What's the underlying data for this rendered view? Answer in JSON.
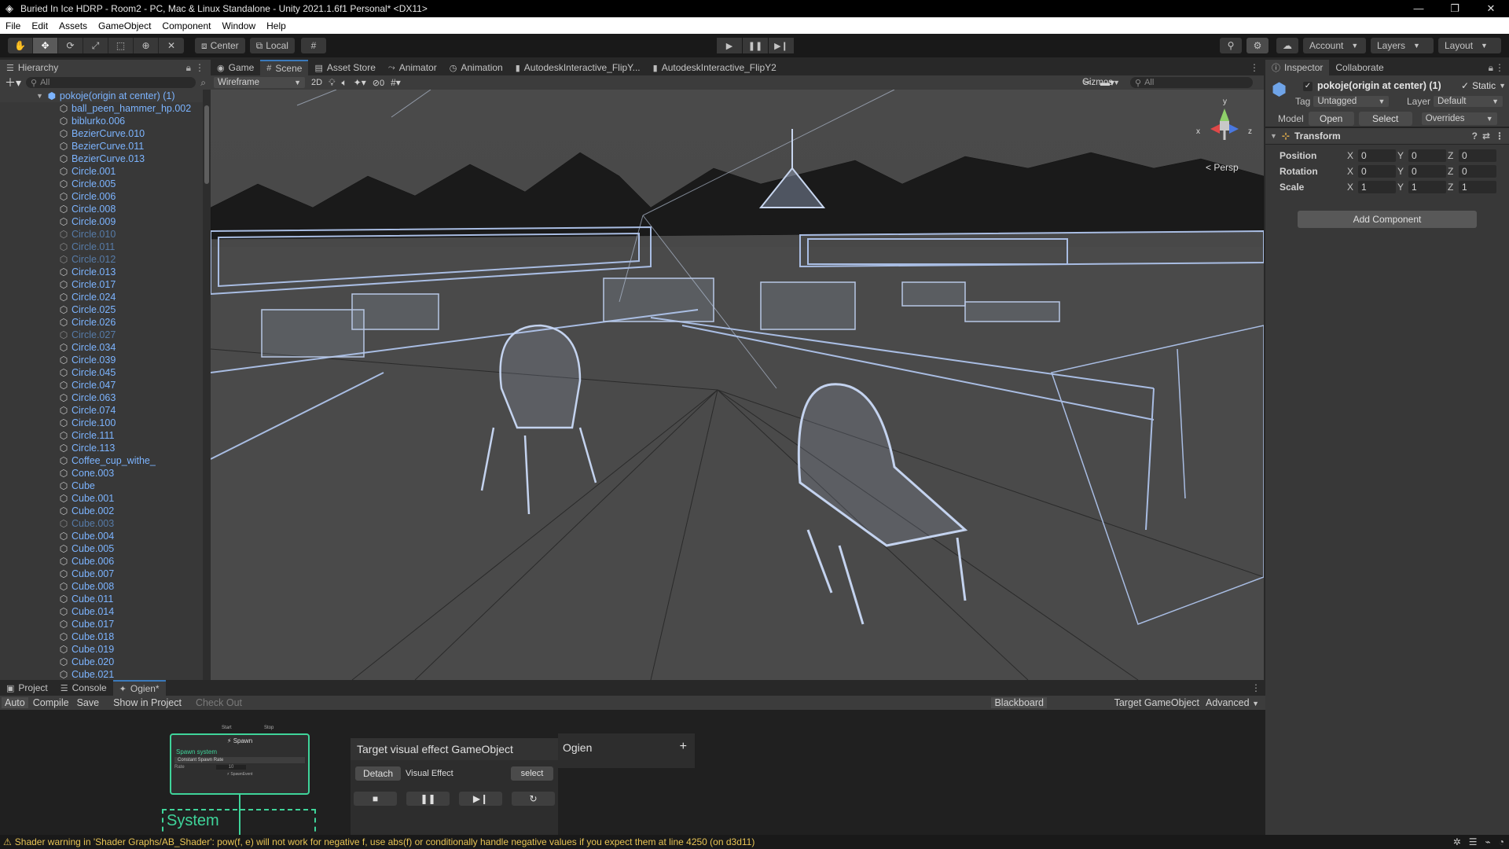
{
  "window": {
    "title": "Buried In Ice HDRP - Room2 - PC, Mac & Linux Standalone - Unity 2021.1.6f1 Personal* <DX11>",
    "controls": [
      "—",
      "❐",
      "✕"
    ]
  },
  "menu": [
    "File",
    "Edit",
    "Assets",
    "GameObject",
    "Component",
    "Window",
    "Help"
  ],
  "toolbar": {
    "pivot_mode": "Center",
    "pivot_rotation": "Local",
    "account": "Account",
    "layers": "Layers",
    "layout": "Layout"
  },
  "hierarchy": {
    "tab": "Hierarchy",
    "search_placeholder": "All",
    "root": "pokoje(origin at center) (1)",
    "items": [
      {
        "name": "ball_peen_hammer_hp.002",
        "dim": false
      },
      {
        "name": "biblurko.006",
        "dim": false
      },
      {
        "name": "BezierCurve.010",
        "dim": false
      },
      {
        "name": "BezierCurve.011",
        "dim": false
      },
      {
        "name": "BezierCurve.013",
        "dim": false
      },
      {
        "name": "Circle.001",
        "dim": false
      },
      {
        "name": "Circle.005",
        "dim": false
      },
      {
        "name": "Circle.006",
        "dim": false
      },
      {
        "name": "Circle.008",
        "dim": false
      },
      {
        "name": "Circle.009",
        "dim": false
      },
      {
        "name": "Circle.010",
        "dim": true
      },
      {
        "name": "Circle.011",
        "dim": true
      },
      {
        "name": "Circle.012",
        "dim": true
      },
      {
        "name": "Circle.013",
        "dim": false
      },
      {
        "name": "Circle.017",
        "dim": false
      },
      {
        "name": "Circle.024",
        "dim": false
      },
      {
        "name": "Circle.025",
        "dim": false
      },
      {
        "name": "Circle.026",
        "dim": false
      },
      {
        "name": "Circle.027",
        "dim": true
      },
      {
        "name": "Circle.034",
        "dim": false
      },
      {
        "name": "Circle.039",
        "dim": false
      },
      {
        "name": "Circle.045",
        "dim": false
      },
      {
        "name": "Circle.047",
        "dim": false
      },
      {
        "name": "Circle.063",
        "dim": false
      },
      {
        "name": "Circle.074",
        "dim": false
      },
      {
        "name": "Circle.100",
        "dim": false
      },
      {
        "name": "Circle.111",
        "dim": false
      },
      {
        "name": "Circle.113",
        "dim": false
      },
      {
        "name": "Coffee_cup_withe_",
        "dim": false
      },
      {
        "name": "Cone.003",
        "dim": false
      },
      {
        "name": "Cube",
        "dim": false
      },
      {
        "name": "Cube.001",
        "dim": false
      },
      {
        "name": "Cube.002",
        "dim": false
      },
      {
        "name": "Cube.003",
        "dim": true
      },
      {
        "name": "Cube.004",
        "dim": false
      },
      {
        "name": "Cube.005",
        "dim": false
      },
      {
        "name": "Cube.006",
        "dim": false
      },
      {
        "name": "Cube.007",
        "dim": false
      },
      {
        "name": "Cube.008",
        "dim": false
      },
      {
        "name": "Cube.011",
        "dim": false
      },
      {
        "name": "Cube.014",
        "dim": false
      },
      {
        "name": "Cube.017",
        "dim": false
      },
      {
        "name": "Cube.018",
        "dim": false
      },
      {
        "name": "Cube.019",
        "dim": false
      },
      {
        "name": "Cube.020",
        "dim": false
      },
      {
        "name": "Cube.021",
        "dim": false
      }
    ]
  },
  "scene": {
    "tabs": [
      {
        "label": "Game",
        "icon": "game-icon",
        "active": false
      },
      {
        "label": "Scene",
        "icon": "scene-icon",
        "active": true
      },
      {
        "label": "Asset Store",
        "icon": "asset-store-icon",
        "active": false
      },
      {
        "label": "Animator",
        "icon": "animator-icon",
        "active": false
      },
      {
        "label": "Animation",
        "icon": "animation-icon",
        "active": false
      },
      {
        "label": "AutodeskInteractive_FlipY...",
        "icon": "material-icon",
        "active": false
      },
      {
        "label": "AutodeskInteractive_FlipY2",
        "icon": "material-icon",
        "active": false
      }
    ],
    "draw_mode": "Wireframe",
    "mode_2d": "2D",
    "hidden_count": "0",
    "gizmos": "Gizmos",
    "search_placeholder": "All",
    "projection": "Persp",
    "axes": {
      "x": "x",
      "y": "y",
      "z": "z"
    }
  },
  "inspector": {
    "tabs": [
      "Inspector",
      "Collaborate"
    ],
    "object_name": "pokoje(origin at center) (1)",
    "static_label": "Static",
    "tag_label": "Tag",
    "tag_value": "Untagged",
    "layer_label": "Layer",
    "layer_value": "Default",
    "model_label": "Model",
    "model_buttons": [
      "Open",
      "Select"
    ],
    "overrides": "Overrides",
    "transform": {
      "title": "Transform",
      "rows": [
        {
          "label": "Position",
          "x": "0",
          "y": "0",
          "z": "0"
        },
        {
          "label": "Rotation",
          "x": "0",
          "y": "0",
          "z": "0"
        },
        {
          "label": "Scale",
          "x": "1",
          "y": "1",
          "z": "1"
        }
      ]
    },
    "add_component": "Add Component"
  },
  "bottom": {
    "tabs": [
      {
        "label": "Project",
        "active": false
      },
      {
        "label": "Console",
        "active": false
      },
      {
        "label": "Ogien*",
        "active": true
      }
    ],
    "toolbar": [
      "Auto",
      "Compile",
      "Save",
      "Show in Project",
      "Check Out"
    ],
    "toolbar_right": [
      "Blackboard",
      "Target GameObject",
      "Advanced"
    ],
    "node": {
      "title": "Spawn",
      "port_start": "Start",
      "port_stop": "Stop",
      "section": "Spawn system",
      "block": "Constant Spawn Rate",
      "rate_label": "Rate",
      "rate_value": "10",
      "output": "SpawnEvent",
      "system_label": "System"
    },
    "target_panel": {
      "title": "Target visual effect GameObject",
      "detach": "Detach",
      "visual_effect": "Visual Effect",
      "select": "select"
    },
    "blackboard": {
      "title": "Ogien",
      "add": "+"
    }
  },
  "status": {
    "message": "Shader warning in 'Shader Graphs/AB_Shader': pow(f, e) will not work for negative f, use abs(f) or conditionally handle negative values if you expect them at line 4250 (on d3d11)"
  }
}
